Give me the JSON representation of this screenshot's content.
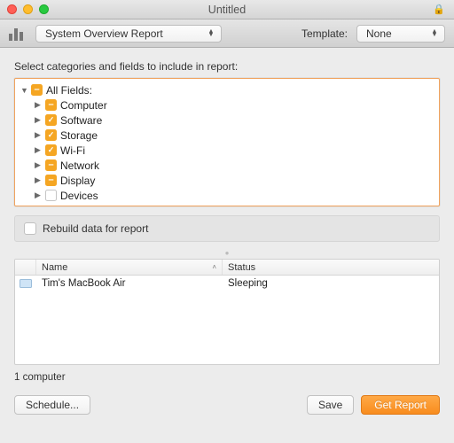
{
  "window": {
    "title": "Untitled"
  },
  "toolbar": {
    "report_type": "System Overview Report",
    "template_label": "Template:",
    "template_value": "None"
  },
  "instruction": "Select categories and fields to include in report:",
  "tree": {
    "root": {
      "label": "All Fields:",
      "state": "mixed",
      "open": true
    },
    "items": [
      {
        "label": "Computer",
        "state": "mixed"
      },
      {
        "label": "Software",
        "state": "checked"
      },
      {
        "label": "Storage",
        "state": "checked"
      },
      {
        "label": "Wi-Fi",
        "state": "checked"
      },
      {
        "label": "Network",
        "state": "mixed"
      },
      {
        "label": "Display",
        "state": "mixed"
      },
      {
        "label": "Devices",
        "state": "unchecked"
      }
    ]
  },
  "rebuild": {
    "label": "Rebuild data for report",
    "checked": false
  },
  "table": {
    "columns": {
      "name": "Name",
      "status": "Status"
    },
    "rows": [
      {
        "name": "Tim's MacBook Air",
        "status": "Sleeping"
      }
    ]
  },
  "count_label": "1 computer",
  "buttons": {
    "schedule": "Schedule...",
    "save": "Save",
    "get_report": "Get Report"
  },
  "colors": {
    "accent": "#f5a623",
    "highlight_border": "#f0a35e"
  }
}
